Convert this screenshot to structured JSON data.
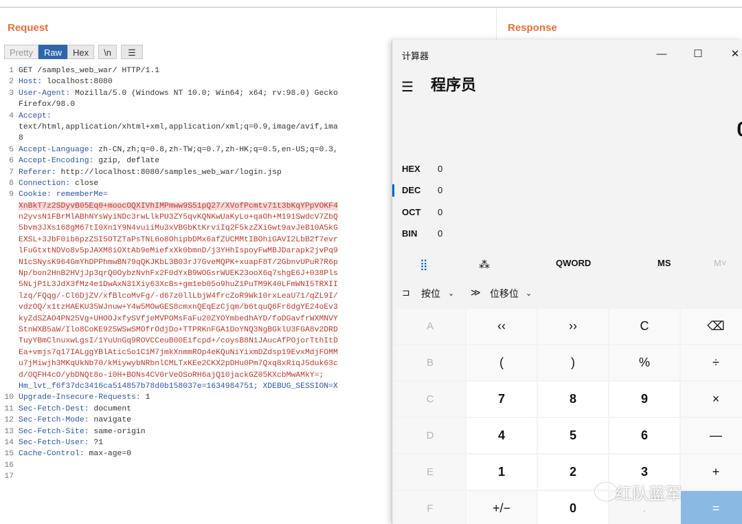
{
  "request": {
    "title": "Request",
    "tabs": [
      "Pretty",
      "Raw",
      "Hex",
      "\\n"
    ],
    "lines": [
      {
        "n": "1",
        "parts": [
          {
            "t": "GET /samples_web_war/ HTTP/1.1",
            "c": ""
          }
        ]
      },
      {
        "n": "2",
        "parts": [
          {
            "t": "Host:",
            "c": "hk"
          },
          {
            "t": " localhost:8080",
            "c": ""
          }
        ]
      },
      {
        "n": "3",
        "parts": [
          {
            "t": "User-Agent:",
            "c": "hk"
          },
          {
            "t": " Mozilla/5.0 (Windows NT 10.0; Win64; x64; rv:98.0) Gecko",
            "c": ""
          }
        ]
      },
      {
        "n": "",
        "parts": [
          {
            "t": "Firefox/98.0",
            "c": ""
          }
        ]
      },
      {
        "n": "4",
        "parts": [
          {
            "t": "Accept:",
            "c": "hk"
          }
        ]
      },
      {
        "n": "",
        "parts": [
          {
            "t": "text/html,application/xhtml+xml,application/xml;q=0.9,image/avif,ima",
            "c": ""
          }
        ]
      },
      {
        "n": "",
        "parts": [
          {
            "t": "8",
            "c": ""
          }
        ]
      },
      {
        "n": "5",
        "parts": [
          {
            "t": "Accept-Language:",
            "c": "hk"
          },
          {
            "t": " zh-CN,zh;q=0.8,zh-TW;q=0.7,zh-HK;q=0.5,en-US;q=0.3,",
            "c": ""
          }
        ]
      },
      {
        "n": "6",
        "parts": [
          {
            "t": "Accept-Encoding:",
            "c": "hk"
          },
          {
            "t": " gzip, deflate",
            "c": ""
          }
        ]
      },
      {
        "n": "7",
        "parts": [
          {
            "t": "Referer:",
            "c": "hk"
          },
          {
            "t": " http://localhost:8080/samples_web_war/login.jsp",
            "c": ""
          }
        ]
      },
      {
        "n": "8",
        "parts": [
          {
            "t": "Connection:",
            "c": "hk"
          },
          {
            "t": " close",
            "c": ""
          }
        ]
      },
      {
        "n": "9",
        "parts": [
          {
            "t": "Cookie:",
            "c": "hk"
          },
          {
            "t": " rememberMe=",
            "c": "hk"
          }
        ]
      },
      {
        "n": "",
        "parts": [
          {
            "t": "XnBkT7z2SDyvB05Eq0+moocOQXIVhIMPmww9S51pQ27/XVofPcmtv71t3bKqYPpVOKF4",
            "c": "cookie sel"
          }
        ]
      },
      {
        "n": "",
        "parts": [
          {
            "t": "n2yvsN1FBrMlABhNYsWyiNDc3rwLlkPU3ZY5qvKQNKwUaKyLo+qaOh+M191SwdcV7ZbQ",
            "c": "cookie"
          }
        ]
      },
      {
        "n": "",
        "parts": [
          {
            "t": "5bvm3JXs168gM67tI0Xn1Y9N4vuiiMu3xVBGbKtKrviIq2F5kzZXiGwt9avJeB10A5kG",
            "c": "cookie"
          }
        ]
      },
      {
        "n": "",
        "parts": [
          {
            "t": "EXSL+3JbF0ib6pzZSI5OTZTaPsTNL6o8OhipbDMx6afZUCMMtIBOhiGAVI2LbB2f7evr",
            "c": "cookie"
          }
        ]
      },
      {
        "n": "",
        "parts": [
          {
            "t": "lFuGtxtNDVo8v5pJAXM8iOXtAb9eMiefxXk0bmnD/j3YHhIspoyFwMBJDarapk2jvPq9",
            "c": "cookie"
          }
        ]
      },
      {
        "n": "",
        "parts": [
          {
            "t": "N1cSNysK964GmYhDPPhmwBN79qQKJKbL3B03rJ7GveMQPK+xuapF8T/2GbnvUPuR7R6p",
            "c": "cookie"
          }
        ]
      },
      {
        "n": "",
        "parts": [
          {
            "t": "Np/bon2HnB2HVjJp3qrQ0OybzNvhFx2F0dYxB9WOGsrWUEK23ooX6q7shgE6J+038Pls",
            "c": "cookie"
          }
        ]
      },
      {
        "n": "",
        "parts": [
          {
            "t": "5NLjP1L3JdX3fMz4e1DwAxN31Xiy63XcBs+gm1eb05o9huZ1PuTM9K40LFmWNI5TRXII",
            "c": "cookie"
          }
        ]
      },
      {
        "n": "",
        "parts": [
          {
            "t": "lzq/FQqg/-Cl6DjZV/xfBlcoMvFg/-d67z0llLbjW4frcZoR9Wk10rxLeaU71/qZL9I/",
            "c": "cookie"
          }
        ]
      },
      {
        "n": "",
        "parts": [
          {
            "t": "vdzOQ/x1tzHAEKU35WJnuw+Y4w5MOwGES8cmxnQEqEzCjqm/b6tquQ6Fr6dgYE24oEv3",
            "c": "cookie"
          }
        ]
      },
      {
        "n": "",
        "parts": [
          {
            "t": "kyZdSZAO4PN25Vg+UHOOJxfySVfjeMVPOMsFaFu20ZYOYmbedhAYD/foDGavfrWXMNVY",
            "c": "cookie"
          }
        ]
      },
      {
        "n": "",
        "parts": [
          {
            "t": "StnWXB5aW/Ilo8CoKE925WSwSMOfrOdjDo+TTPRKnFGA1DoYNQ3NgBGklU3FGA8v2DRD",
            "c": "cookie"
          }
        ]
      },
      {
        "n": "",
        "parts": [
          {
            "t": "TuyYBmClnuxwLgsI/1YuUnGq9ROVCCeuB00Eifcpd+/coysB8N1JAucAfPOjorTthItD",
            "c": "cookie"
          }
        ]
      },
      {
        "n": "",
        "parts": [
          {
            "t": "Ea+vmjs7q17IALggYBlAtic5o1C1M7jmkXnmmROp4eKQuNiYixmDZdsp19EvxMdjFOMM",
            "c": "cookie"
          }
        ]
      },
      {
        "n": "",
        "parts": [
          {
            "t": "u7jMiwjh3MKqUkNb70/kMiywybNRbnlCMLTxKEe2CKX2pDHu0Pm7Qxq8xRiqJ5duk63c",
            "c": "cookie"
          }
        ]
      },
      {
        "n": "",
        "parts": [
          {
            "t": "d/OQFH4cO/ybDNQt8o-i0H+BONs4CV0rVeOSoRH6ajQ10jackGZ05KXcbMwAMkY=;",
            "c": "cookie"
          }
        ]
      },
      {
        "n": "",
        "parts": [
          {
            "t": "Hm_lvt_f6f37dc3416ca514857b78d0b158037e=1634984751; XDEBUG_SESSION=X",
            "c": "hk"
          }
        ]
      },
      {
        "n": "10",
        "parts": [
          {
            "t": "Upgrade-Insecure-Requests:",
            "c": "hk"
          },
          {
            "t": " 1",
            "c": ""
          }
        ]
      },
      {
        "n": "11",
        "parts": [
          {
            "t": "Sec-Fetch-Dest:",
            "c": "hk"
          },
          {
            "t": " document",
            "c": ""
          }
        ]
      },
      {
        "n": "12",
        "parts": [
          {
            "t": "Sec-Fetch-Mode:",
            "c": "hk"
          },
          {
            "t": " navigate",
            "c": ""
          }
        ]
      },
      {
        "n": "13",
        "parts": [
          {
            "t": "Sec-Fetch-Site:",
            "c": "hk"
          },
          {
            "t": " same-origin",
            "c": ""
          }
        ]
      },
      {
        "n": "14",
        "parts": [
          {
            "t": "Sec-Fetch-User:",
            "c": "hk"
          },
          {
            "t": " ?1",
            "c": ""
          }
        ]
      },
      {
        "n": "15",
        "parts": [
          {
            "t": "Cache-Control:",
            "c": "hk"
          },
          {
            "t": " max-age=0",
            "c": ""
          }
        ]
      },
      {
        "n": "16",
        "parts": []
      },
      {
        "n": "17",
        "parts": []
      }
    ]
  },
  "response": {
    "title": "Response"
  },
  "calculator": {
    "window_title": "计算器",
    "mode": "程序员",
    "display": "0",
    "radix": [
      {
        "label": "HEX",
        "value": "0"
      },
      {
        "label": "DEC",
        "value": "0"
      },
      {
        "label": "OCT",
        "value": "0"
      },
      {
        "label": "BIN",
        "value": "0"
      }
    ],
    "word_size": "QWORD",
    "mem_ms": "MS",
    "mem_m": "M˅",
    "bitwise_label": "按位",
    "bitshift_label": "位移位",
    "keys": [
      {
        "t": "A",
        "k": "dis"
      },
      {
        "t": "‹‹",
        "k": ""
      },
      {
        "t": "››",
        "k": ""
      },
      {
        "t": "C",
        "k": ""
      },
      {
        "t": "⌫",
        "k": ""
      },
      {
        "t": "B",
        "k": "dis"
      },
      {
        "t": "(",
        "k": ""
      },
      {
        "t": ")",
        "k": ""
      },
      {
        "t": "%",
        "k": ""
      },
      {
        "t": "÷",
        "k": ""
      },
      {
        "t": "C",
        "k": "dis"
      },
      {
        "t": "7",
        "k": "num"
      },
      {
        "t": "8",
        "k": "num"
      },
      {
        "t": "9",
        "k": "num"
      },
      {
        "t": "×",
        "k": ""
      },
      {
        "t": "D",
        "k": "dis"
      },
      {
        "t": "4",
        "k": "num"
      },
      {
        "t": "5",
        "k": "num"
      },
      {
        "t": "6",
        "k": "num"
      },
      {
        "t": "—",
        "k": ""
      },
      {
        "t": "E",
        "k": "dis"
      },
      {
        "t": "1",
        "k": "num"
      },
      {
        "t": "2",
        "k": "num"
      },
      {
        "t": "3",
        "k": "num"
      },
      {
        "t": "+",
        "k": ""
      },
      {
        "t": "F",
        "k": "dis"
      },
      {
        "t": "+/−",
        "k": ""
      },
      {
        "t": "0",
        "k": "num"
      },
      {
        "t": ".",
        "k": "dis"
      },
      {
        "t": "=",
        "k": "eq"
      }
    ]
  },
  "watermark": "红队蓝军"
}
